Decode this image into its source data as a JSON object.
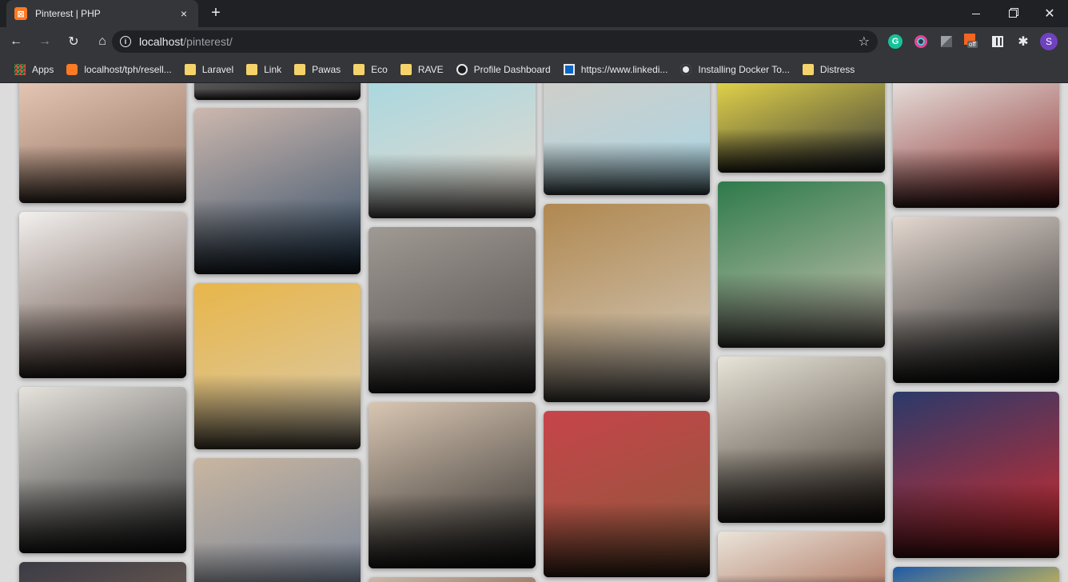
{
  "tab": {
    "title": "Pinterest | PHP",
    "favicon": "xampp-icon",
    "close": "×"
  },
  "new_tab": "+",
  "window": {
    "minimize": "",
    "maximize": "",
    "close": ""
  },
  "toolbar": {
    "back": "←",
    "forward": "→",
    "reload": "↻",
    "home": "⌂"
  },
  "address": {
    "host": "localhost",
    "path": "/pinterest/",
    "bookmark_star": "☆"
  },
  "extensions": {
    "grammarly": "G",
    "off_badge": "off",
    "puzzle": "✱",
    "avatar": "S"
  },
  "bookmarks": [
    {
      "label": "Apps",
      "icon": "apps-icon"
    },
    {
      "label": "localhost/tph/resell...",
      "icon": "xampp-icon"
    },
    {
      "label": "Laravel",
      "icon": "folder-icon"
    },
    {
      "label": "Link",
      "icon": "folder-icon"
    },
    {
      "label": "Pawas",
      "icon": "folder-icon"
    },
    {
      "label": "Eco",
      "icon": "folder-icon"
    },
    {
      "label": "RAVE",
      "icon": "folder-icon"
    },
    {
      "label": "Profile Dashboard",
      "icon": "github-icon"
    },
    {
      "label": "https://www.linkedi...",
      "icon": "linkedin-icon"
    },
    {
      "label": "Installing Docker To...",
      "icon": "globe-icon"
    },
    {
      "label": "Distress",
      "icon": "folder-icon"
    }
  ],
  "pins": [
    {
      "name": "pin-skin-treatment",
      "colors": [
        "#e8c9b8",
        "#8a6a58"
      ]
    },
    {
      "name": "pin-deepika-white",
      "colors": [
        "#f2f0ee",
        "#5a4036"
      ]
    },
    {
      "name": "pin-kareena-karisma-sweaters",
      "colors": [
        "#e6e2dc",
        "#2a2a2a"
      ]
    },
    {
      "name": "pin-actors-row",
      "colors": [
        "#3b3b46",
        "#6a5a50"
      ]
    },
    {
      "name": "pin-top-strip",
      "colors": [
        "#5a5a5a",
        "#2a2a2a"
      ]
    },
    {
      "name": "pin-kareena-blue-lehenga",
      "colors": [
        "#cdb8ae",
        "#2e4a66"
      ]
    },
    {
      "name": "pin-honey-dipper",
      "colors": [
        "#e8b64a",
        "#d9cbb0"
      ]
    },
    {
      "name": "pin-blonde-woman",
      "colors": [
        "#c9b6a0",
        "#6d7e98"
      ]
    },
    {
      "name": "pin-sky-blue-outfits",
      "colors": [
        "#a8d8e0",
        "#e7d8cc"
      ]
    },
    {
      "name": "pin-sara-denim-dress",
      "colors": [
        "#a09a94",
        "#4a4644"
      ]
    },
    {
      "name": "pin-black-mini-dresses",
      "colors": [
        "#d9c6b2",
        "#252525"
      ]
    },
    {
      "name": "pin-bottom-strip-3",
      "colors": [
        "#c9b8a8",
        "#8b6b58"
      ]
    },
    {
      "name": "pin-gym-outfit",
      "colors": [
        "#d0cec8",
        "#a9d6e6"
      ]
    },
    {
      "name": "pin-malaika-lace",
      "colors": [
        "#b08850",
        "#d6cfc4"
      ]
    },
    {
      "name": "pin-karisma-red-suits",
      "colors": [
        "#c7444a",
        "#8a5a3a"
      ]
    },
    {
      "name": "pin-yellow-outfits",
      "colors": [
        "#e8d84a",
        "#3a3a3a"
      ]
    },
    {
      "name": "pin-kangana-green-saree",
      "colors": [
        "#2e7a4a",
        "#d0c8b8"
      ]
    },
    {
      "name": "pin-katrina-earrings",
      "colors": [
        "#e8e4d8",
        "#3a3028"
      ]
    },
    {
      "name": "pin-white-outfits",
      "colors": [
        "#eae4da",
        "#a86a54"
      ]
    },
    {
      "name": "pin-white-sarees",
      "colors": [
        "#e8e4e0",
        "#8a2a2a"
      ]
    },
    {
      "name": "pin-black-cutout-gowns",
      "colors": [
        "#e4d8d0",
        "#1a1a1a"
      ]
    },
    {
      "name": "pin-red-pantsuits",
      "colors": [
        "#2a3a6a",
        "#d62a2a"
      ]
    },
    {
      "name": "pin-bottom-strip-6",
      "colors": [
        "#1e5aa8",
        "#e8c84a"
      ]
    }
  ]
}
